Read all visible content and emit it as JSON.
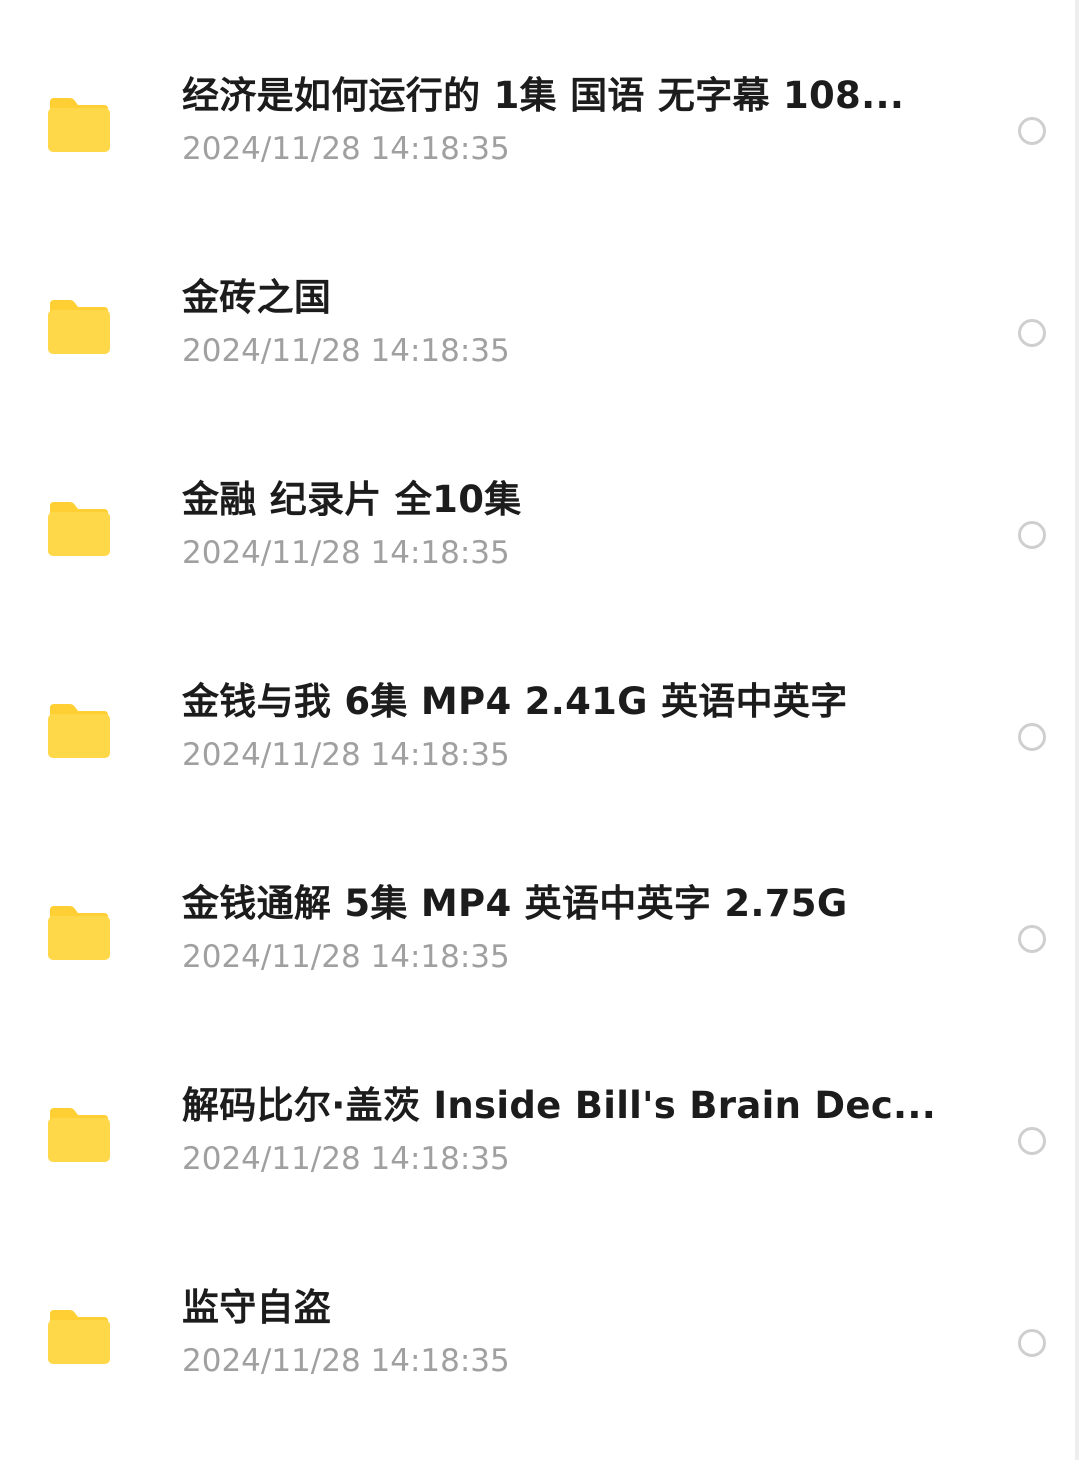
{
  "colors": {
    "folder": "#FFD84A",
    "folder_tab": "#FFCF33",
    "name_text": "#1C1C1C",
    "date_text": "#A0A0A0",
    "radio_border": "#CFCFCF",
    "background": "#FFFFFF"
  },
  "icons": {
    "item": "folder-icon",
    "select": "radio-circle-icon"
  },
  "files": [
    {
      "name": "经济是如何运行的 1集 国语 无字幕 108...",
      "date": "2024/11/28 14:18:35"
    },
    {
      "name": "金砖之国",
      "date": "2024/11/28 14:18:35"
    },
    {
      "name": "金融 纪录片 全10集",
      "date": "2024/11/28 14:18:35"
    },
    {
      "name": "金钱与我 6集 MP4 2.41G 英语中英字",
      "date": "2024/11/28 14:18:35"
    },
    {
      "name": "金钱通解 5集 MP4 英语中英字 2.75G",
      "date": "2024/11/28 14:18:35"
    },
    {
      "name": "解码比尔·盖茨 Inside Bill's Brain Dec...",
      "date": "2024/11/28 14:18:35"
    },
    {
      "name": "监守自盗",
      "date": "2024/11/28 14:18:35"
    }
  ]
}
